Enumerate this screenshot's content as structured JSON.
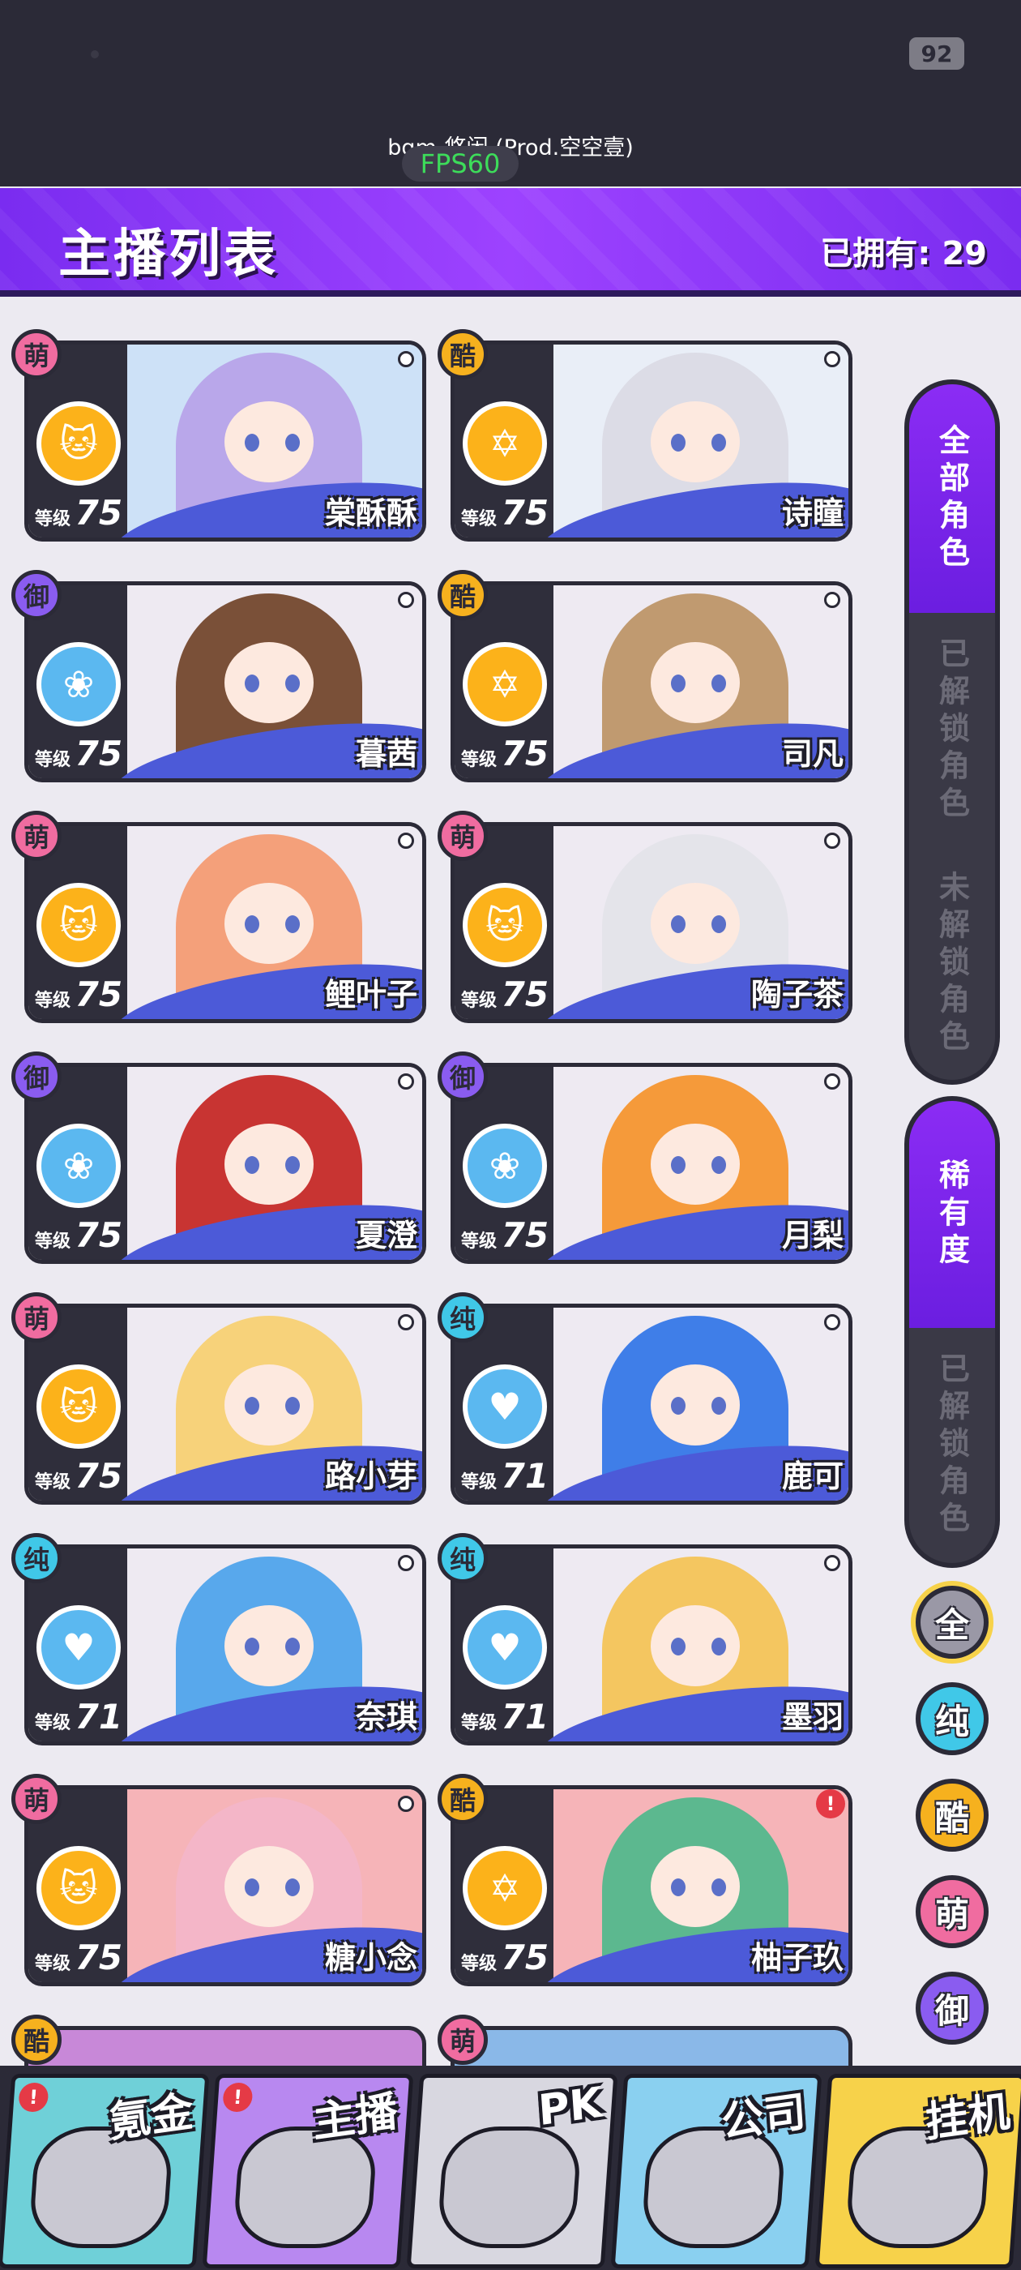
{
  "status": {
    "battery": "92",
    "bgm": "bgm-悠闲 (Prod.空空壹)",
    "fps": "FPS60"
  },
  "header": {
    "title": "主播列表",
    "owned": "已拥有: 29"
  },
  "cards": [
    {
      "name": "棠酥酥",
      "rarity": "萌",
      "level_label": "等级",
      "level": "75",
      "attr_icon": "cat-icon",
      "hair": "#b9a7ea",
      "bg": "#cde1f7",
      "rarity_color": "#f06ca0"
    },
    {
      "name": "诗瞳",
      "rarity": "酷",
      "level_label": "等级",
      "level": "75",
      "attr_icon": "star-icon",
      "hair": "#dcdce6",
      "bg": "#e9eef7",
      "rarity_color": "#f6b11e"
    },
    {
      "name": "暮茜",
      "rarity": "御",
      "level_label": "等级",
      "level": "75",
      "attr_icon": "rose-icon",
      "hair": "#7a5038",
      "bg": "#eeeaf2",
      "rarity_color": "#8a5cf0"
    },
    {
      "name": "司凡",
      "rarity": "酷",
      "level_label": "等级",
      "level": "75",
      "attr_icon": "star-icon",
      "hair": "#c09a70",
      "bg": "#eeeaf2",
      "rarity_color": "#f6b11e"
    },
    {
      "name": "鲤叶子",
      "rarity": "萌",
      "level_label": "等级",
      "level": "75",
      "attr_icon": "cat-icon",
      "hair": "#f4a07a",
      "bg": "#eeeaf2",
      "rarity_color": "#f06ca0"
    },
    {
      "name": "陶子茶",
      "rarity": "萌",
      "level_label": "等级",
      "level": "75",
      "attr_icon": "cat-icon",
      "hair": "#e4e4ea",
      "bg": "#eeeaf2",
      "rarity_color": "#f06ca0"
    },
    {
      "name": "夏澄",
      "rarity": "御",
      "level_label": "等级",
      "level": "75",
      "attr_icon": "rose-icon",
      "hair": "#c83432",
      "bg": "#eeeaf2",
      "rarity_color": "#8a5cf0"
    },
    {
      "name": "月梨",
      "rarity": "御",
      "level_label": "等级",
      "level": "75",
      "attr_icon": "rose-icon",
      "hair": "#f59a3a",
      "bg": "#eeeaf2",
      "rarity_color": "#8a5cf0"
    },
    {
      "name": "路小芽",
      "rarity": "萌",
      "level_label": "等级",
      "level": "75",
      "attr_icon": "cat-icon",
      "hair": "#f7d27a",
      "bg": "#eeeaf2",
      "rarity_color": "#f06ca0"
    },
    {
      "name": "鹿可",
      "rarity": "纯",
      "level_label": "等级",
      "level": "71",
      "attr_icon": "pulse-icon",
      "hair": "#3f7ee8",
      "bg": "#eeeaf2",
      "rarity_color": "#40c8e8"
    },
    {
      "name": "奈琪",
      "rarity": "纯",
      "level_label": "等级",
      "level": "71",
      "attr_icon": "pulse-icon",
      "hair": "#58a8ec",
      "bg": "#eeeaf2",
      "rarity_color": "#40c8e8"
    },
    {
      "name": "墨羽",
      "rarity": "纯",
      "level_label": "等级",
      "level": "71",
      "attr_icon": "pulse-icon",
      "hair": "#f4c660",
      "bg": "#eeeaf2",
      "rarity_color": "#40c8e8"
    },
    {
      "name": "糖小念",
      "rarity": "萌",
      "level_label": "等级",
      "level": "75",
      "attr_icon": "cat-icon",
      "hair": "#f4b6c8",
      "bg": "#f6b4b8",
      "rarity_color": "#f06ca0"
    },
    {
      "name": "柚子玖",
      "rarity": "酷",
      "level_label": "等级",
      "level": "75",
      "attr_icon": "star-icon",
      "hair": "#5cb88f",
      "bg": "#f6b4b8",
      "rarity_color": "#f6b11e",
      "alert": "!"
    }
  ],
  "partial_rarities": [
    "酷",
    "萌"
  ],
  "filters": {
    "roles": [
      "全部角色",
      "已解锁角色",
      "未解锁角色"
    ],
    "rarity": [
      "稀有度",
      "已解锁角色"
    ],
    "rarity_buttons": [
      {
        "label": "全",
        "color": "#9a98a6"
      },
      {
        "label": "纯",
        "color": "#40c8e8"
      },
      {
        "label": "酷",
        "color": "#f6b11e"
      },
      {
        "label": "萌",
        "color": "#f06ca0"
      },
      {
        "label": "御",
        "color": "#8a5cf0"
      }
    ]
  },
  "tabs": [
    {
      "label": "氪金",
      "bg": "#6fd0d8",
      "badge": "!"
    },
    {
      "label": "主播",
      "bg": "#b888f0",
      "badge": "!"
    },
    {
      "label": "PK",
      "bg": "#d8d7e0",
      "badge": ""
    },
    {
      "label": "公司",
      "bg": "#8ad0f0",
      "badge": ""
    },
    {
      "label": "挂机",
      "bg": "#f7d24a",
      "badge": ""
    }
  ]
}
